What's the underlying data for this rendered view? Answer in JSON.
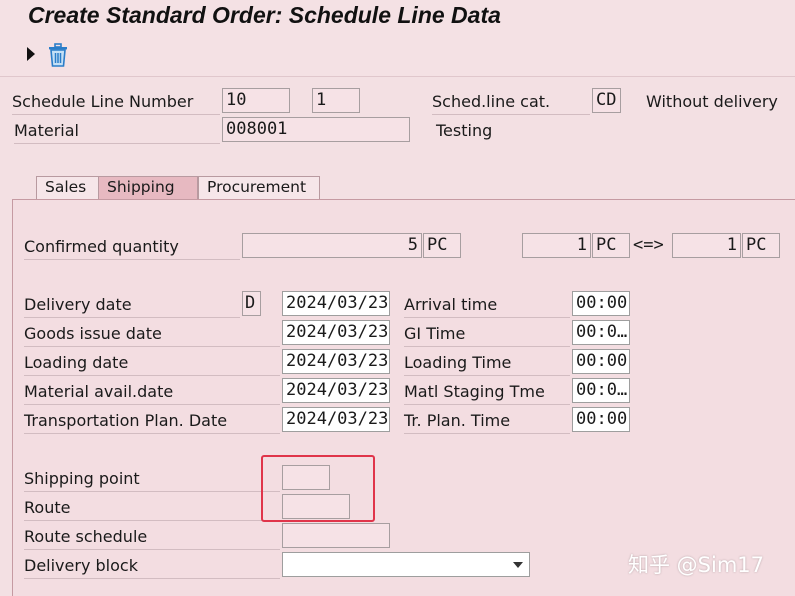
{
  "title": "Create Standard Order: Schedule Line Data",
  "header": {
    "schedule_line_number_label": "Schedule Line Number",
    "schedule_line_number_value": "10",
    "schedule_line_sub_value": "1",
    "sched_line_cat_label": "Sched.line cat.",
    "sched_line_cat_value": "CD",
    "sched_line_cat_desc": "Without delivery",
    "material_label": "Material",
    "material_value": "008001",
    "material_desc": "Testing"
  },
  "tabs": [
    {
      "label": "Sales",
      "active": false
    },
    {
      "label": "Shipping",
      "active": true
    },
    {
      "label": "Procurement",
      "active": false
    }
  ],
  "confirmed": {
    "label": "Confirmed quantity",
    "qty": "5",
    "unit": "PC",
    "qty2": "1",
    "unit2": "PC",
    "conversion_symbol": "<=>",
    "qty3": "1",
    "unit3": "PC"
  },
  "dates": [
    {
      "label": "Delivery date",
      "format": "D",
      "date": "2024/03/23",
      "time_label": "Arrival time",
      "time": "00:00"
    },
    {
      "label": "Goods issue date",
      "format": "",
      "date": "2024/03/23",
      "time_label": "GI Time",
      "time": "00:0…"
    },
    {
      "label": "Loading date",
      "format": "",
      "date": "2024/03/23",
      "time_label": "Loading Time",
      "time": "00:00"
    },
    {
      "label": "Material avail.date",
      "format": "",
      "date": "2024/03/23",
      "time_label": "Matl Staging Tme",
      "time": "00:0…"
    },
    {
      "label": "Transportation Plan. Date",
      "format": "",
      "date": "2024/03/23",
      "time_label": "Tr. Plan. Time",
      "time": "00:00"
    }
  ],
  "shipping": {
    "shipping_point_label": "Shipping point",
    "shipping_point_value": "",
    "route_label": "Route",
    "route_value": "",
    "route_schedule_label": "Route schedule",
    "route_schedule_value": "",
    "delivery_block_label": "Delivery block",
    "delivery_block_value": ""
  },
  "icons": {
    "execute": "execute-arrow-icon",
    "delete": "trash-icon"
  },
  "colors": {
    "background": "#f3e0e3",
    "highlight": "#e0344a",
    "active_tab": "#e7b9c1"
  },
  "watermark": "知乎 @Sim17"
}
